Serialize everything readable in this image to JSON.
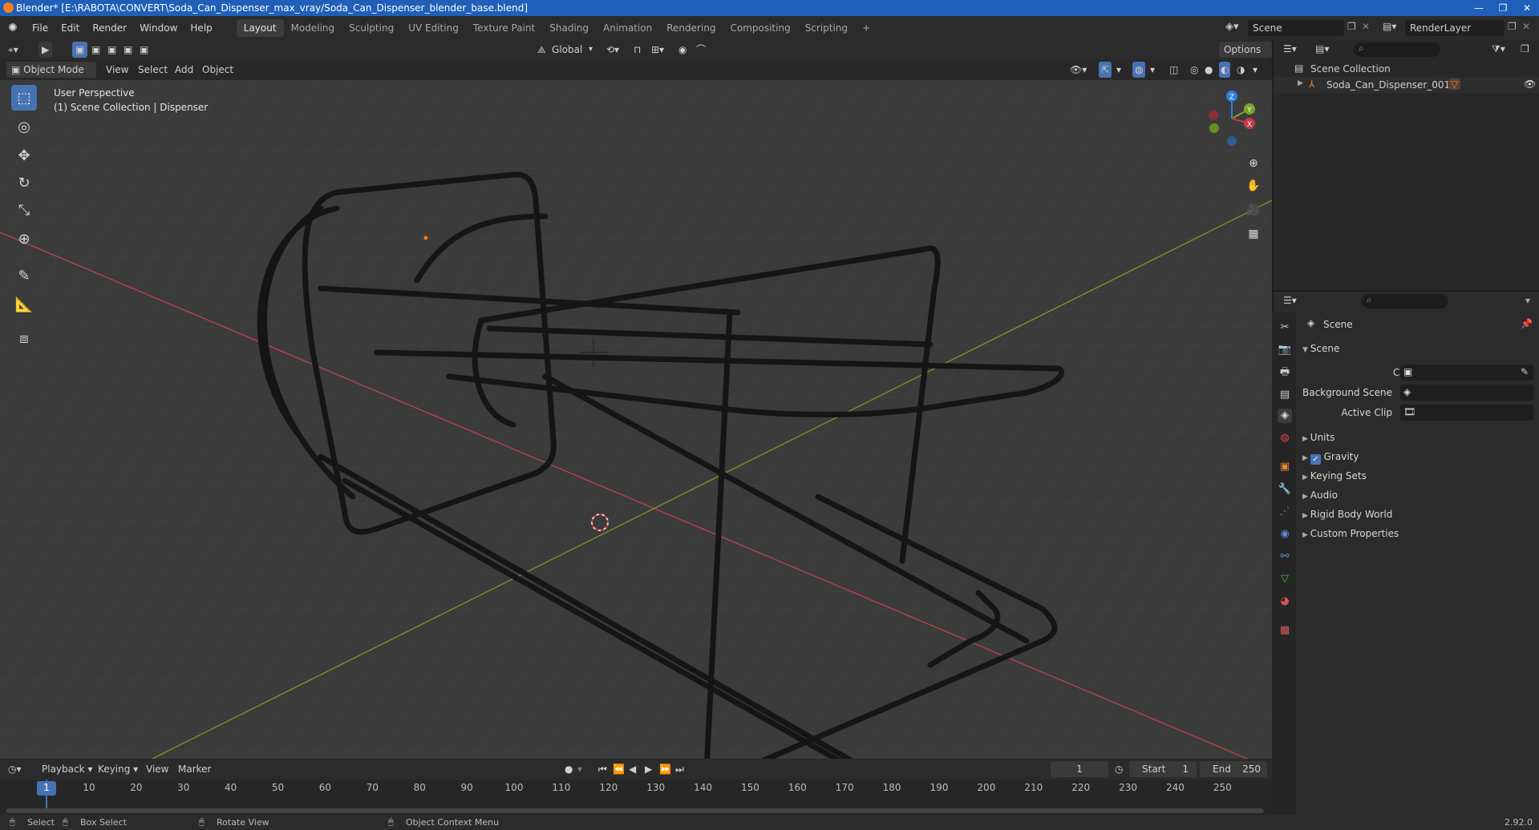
{
  "window": {
    "title": "Blender* [E:\\RABOTA\\CONVERT\\Soda_Can_Dispenser_max_vray/Soda_Can_Dispenser_blender_base.blend]",
    "controls": [
      "—",
      "❐",
      "✕"
    ]
  },
  "topbar": {
    "menus": [
      "File",
      "Edit",
      "Render",
      "Window",
      "Help"
    ],
    "workspaces": [
      "Layout",
      "Modeling",
      "Sculpting",
      "UV Editing",
      "Texture Paint",
      "Shading",
      "Animation",
      "Rendering",
      "Compositing",
      "Scripting"
    ],
    "active_workspace": "Layout",
    "add_tab": "+",
    "scene_name": "Scene",
    "view_layer": "RenderLayer"
  },
  "viewport_header": {
    "mode": "Object Mode",
    "menus": [
      "View",
      "Select",
      "Add",
      "Object"
    ],
    "transform_orientation": "Global",
    "options_label": "Options"
  },
  "viewport": {
    "perspective_label": "User Perspective",
    "collection_label": "(1) Scene Collection | Dispenser",
    "gizmo_axes": {
      "z": "Z",
      "y": "Y",
      "x": "X"
    }
  },
  "toolbar": {
    "tools": [
      {
        "name": "select-box-tool",
        "icon": "⬚",
        "active": true
      },
      {
        "name": "cursor-tool",
        "icon": "◎",
        "active": false
      },
      {
        "name": "move-tool",
        "icon": "✥",
        "active": false
      },
      {
        "name": "rotate-tool",
        "icon": "↻",
        "active": false
      },
      {
        "name": "scale-tool",
        "icon": "⤡",
        "active": false
      },
      {
        "name": "transform-tool",
        "icon": "⊕",
        "active": false
      },
      {
        "name": "annotate-tool",
        "icon": "✎",
        "active": false
      },
      {
        "name": "measure-tool",
        "icon": "📐",
        "active": false
      },
      {
        "name": "add-cube-tool",
        "icon": "⧈",
        "active": false
      }
    ]
  },
  "outliner": {
    "root": "Scene Collection",
    "items": [
      {
        "label": "Soda_Can_Dispenser_001"
      }
    ]
  },
  "properties": {
    "context": "Scene",
    "panel_title": "Scene",
    "fields": [
      {
        "label": "Camera",
        "value": ""
      },
      {
        "label": "Background Scene",
        "value": ""
      },
      {
        "label": "Active Clip",
        "value": ""
      }
    ],
    "sections": [
      "Units",
      "Gravity",
      "Keying Sets",
      "Audio",
      "Rigid Body World",
      "Custom Properties"
    ],
    "gravity_checked": true
  },
  "timeline": {
    "menus": [
      "Playback",
      "Keying",
      "View",
      "Marker"
    ],
    "current_frame": "1",
    "start_label": "Start",
    "start_value": "1",
    "end_label": "End",
    "end_value": "250",
    "ticks": [
      "1",
      "10",
      "20",
      "30",
      "40",
      "50",
      "60",
      "70",
      "80",
      "90",
      "100",
      "110",
      "120",
      "130",
      "140",
      "150",
      "160",
      "170",
      "180",
      "190",
      "200",
      "210",
      "220",
      "230",
      "240",
      "250"
    ]
  },
  "statusbar": {
    "items": [
      "Select",
      "Box Select",
      "Rotate View",
      "Object Context Menu"
    ],
    "version": "2.92.0"
  },
  "colors": {
    "accent": "#4772b3",
    "x_axis": "#c33a4a",
    "y_axis": "#7ea32d",
    "z_axis": "#2f80e0"
  }
}
